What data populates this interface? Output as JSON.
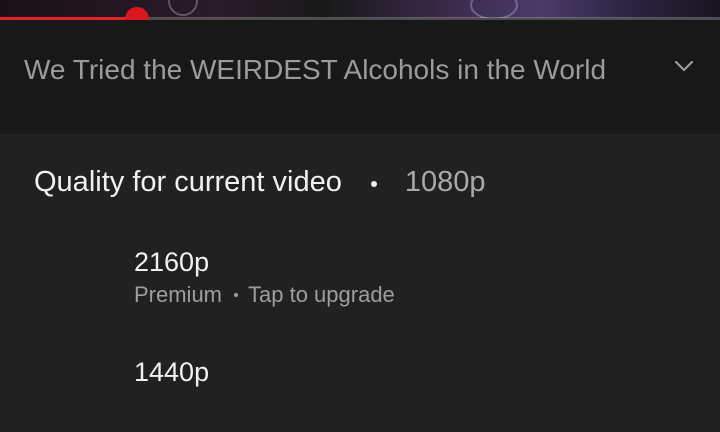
{
  "progress": {
    "played_fraction": 0.19
  },
  "video": {
    "title": "We Tried the WEIRDEST Alcohols in the World",
    "expand_icon": "chevron-down-icon"
  },
  "quality_sheet": {
    "heading": "Quality for current video",
    "current_quality": "1080p",
    "options": [
      {
        "label": "2160p",
        "tier": "Premium",
        "note": "Tap to upgrade"
      },
      {
        "label": "1440p"
      }
    ]
  },
  "colors": {
    "progress_accent": "#e5212a",
    "sheet_background": "#212121",
    "title_background": "#181818"
  }
}
